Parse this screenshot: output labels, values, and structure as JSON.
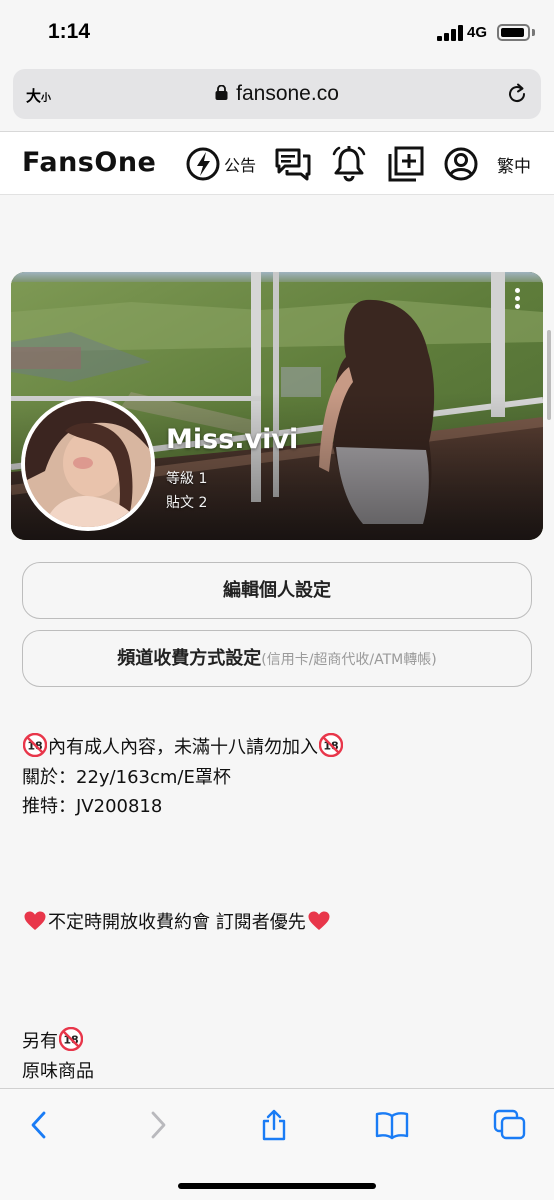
{
  "status_bar": {
    "time": "1:14",
    "network": "4G"
  },
  "browser": {
    "text_size_label": "大",
    "text_size_small": "小",
    "url": "fansone.co"
  },
  "header": {
    "logo": "FansOne",
    "announce_label": "公告",
    "language": "繁中"
  },
  "profile": {
    "name": "Miss.vivi",
    "level": "等級 1",
    "posts": "貼文 2"
  },
  "buttons": {
    "edit_profile": "編輯個人設定",
    "payment_settings": "頻道收費方式設定",
    "payment_note": "(信用卡/超商代收/ATM轉帳)"
  },
  "bio": {
    "line1": "內有成人內容，未滿十八請勿加入",
    "line2": "關於：22y/163cm/E罩杯",
    "line3": "推特：JV200818",
    "line4": "不定時開放收費約會 訂閱者優先",
    "line5": "另有",
    "line6": "原味商品"
  },
  "colors": {
    "accent_red": "#e8364a",
    "ios_blue": "#1a7cf5"
  }
}
